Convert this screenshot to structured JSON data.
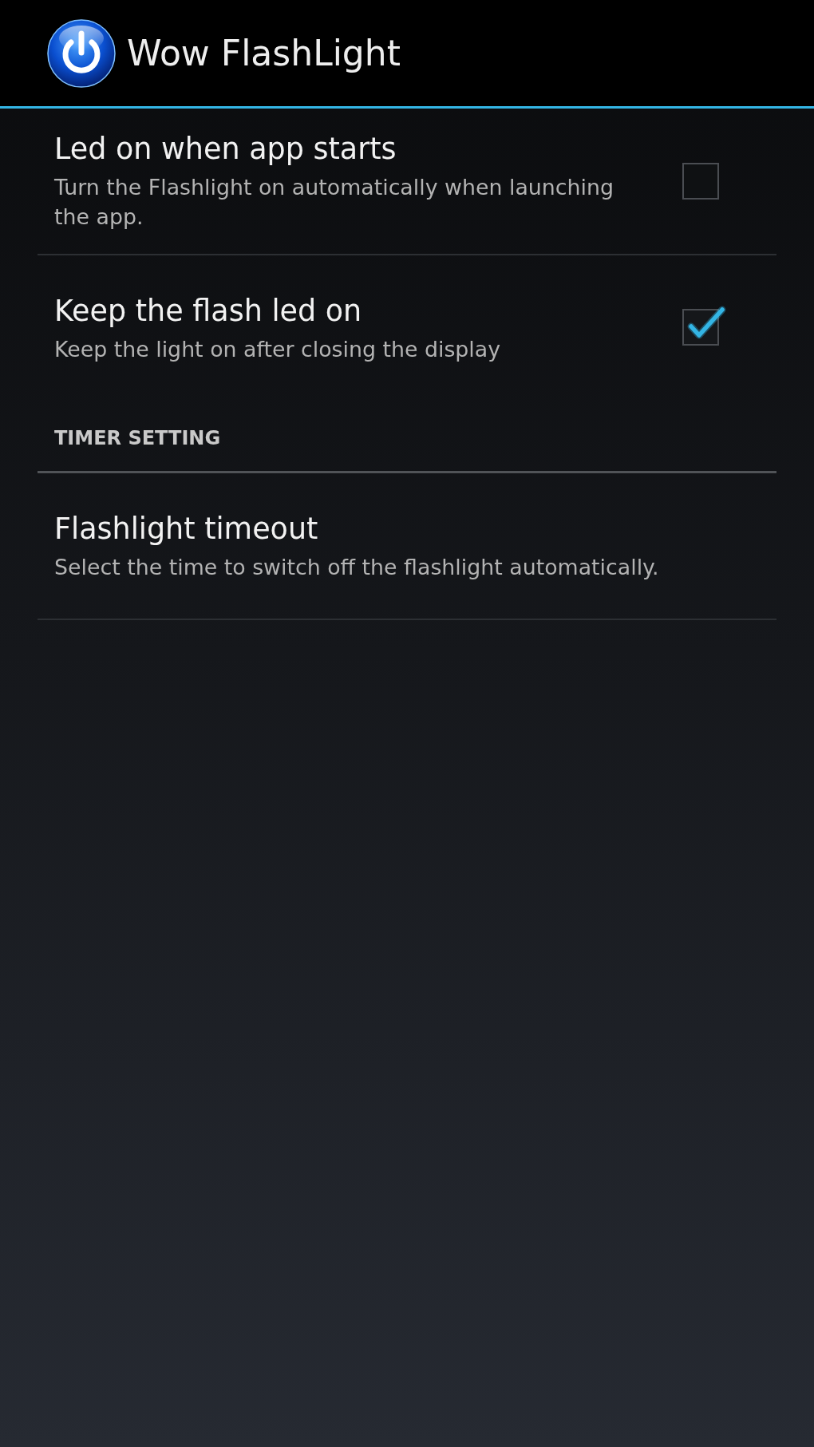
{
  "app_bar": {
    "title": "Wow FlashLight"
  },
  "preferences": [
    {
      "kind": "checkbox",
      "title": "Led on when app starts",
      "summary": "Turn the Flashlight on automatically when launching the app.",
      "checked": false
    },
    {
      "kind": "checkbox",
      "title": "Keep the flash led on",
      "summary": "Keep the light on after closing the display",
      "checked": true
    },
    {
      "kind": "category",
      "title": "TIMER SETTING"
    },
    {
      "kind": "item",
      "title": "Flashlight timeout",
      "summary": "Select the time to switch off the flashlight automatically."
    }
  ]
}
